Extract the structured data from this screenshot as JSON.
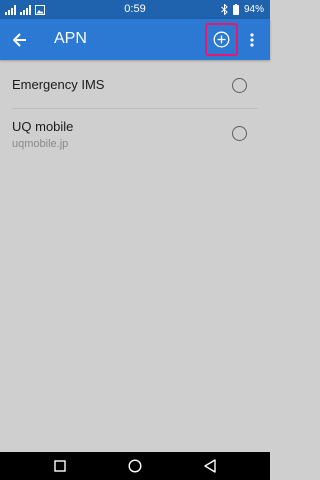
{
  "status_bar": {
    "time": "0:59",
    "battery": "94%"
  },
  "header": {
    "title": "APN",
    "back_icon": "arrow-back-icon",
    "add_icon": "add-circle-icon",
    "more_icon": "more-vert-icon"
  },
  "apn_list": [
    {
      "name": "Emergency IMS",
      "detail": "",
      "selected": false
    },
    {
      "name": "UQ mobile",
      "detail": "uqmobile.jp",
      "selected": false
    }
  ],
  "nav_bar": {
    "recents_icon": "square-icon",
    "home_icon": "circle-icon",
    "back_icon": "triangle-back-icon"
  },
  "colors": {
    "status_bar": "#1f62ad",
    "app_bar": "#2b79d3",
    "background": "#cfcfcf",
    "highlight": "#e8186e"
  }
}
